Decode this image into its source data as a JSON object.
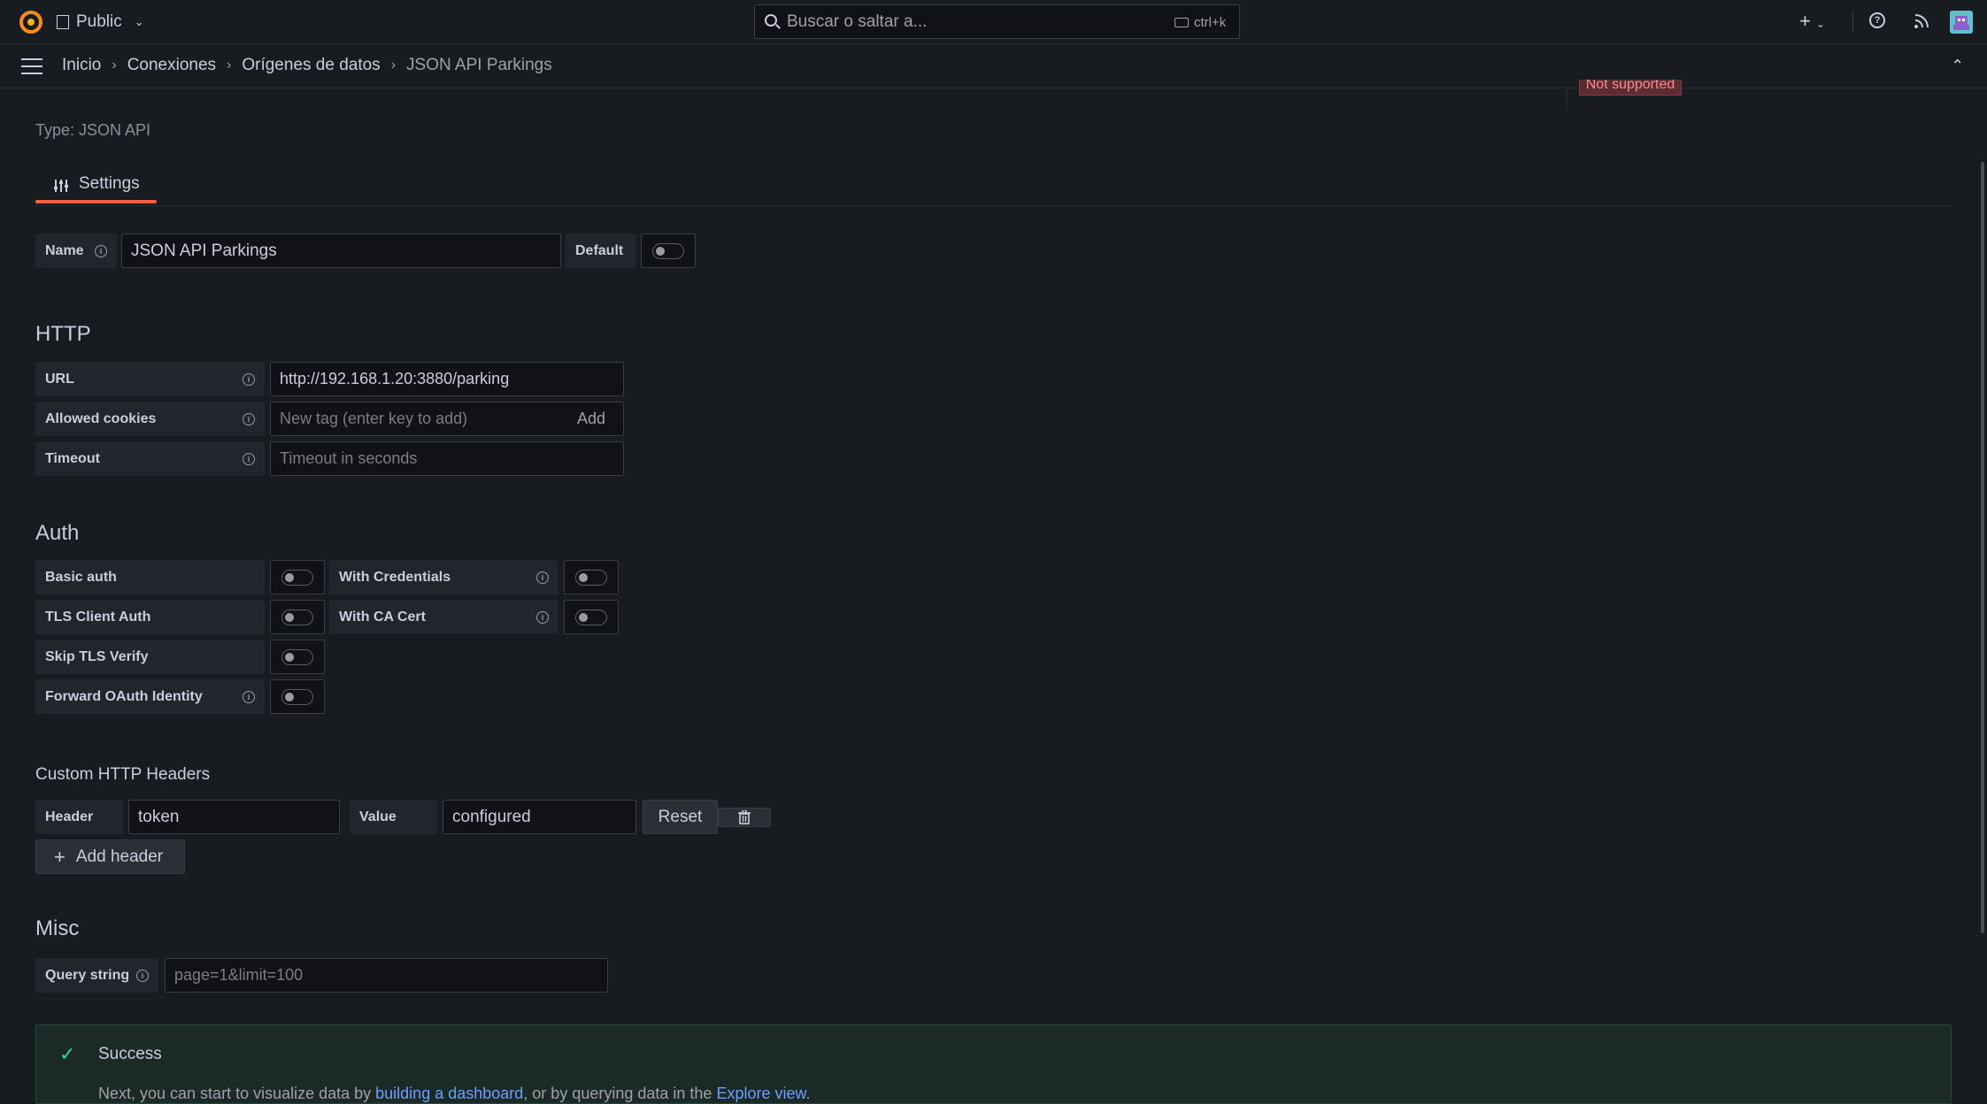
{
  "topbar": {
    "org_label": "Public",
    "search_placeholder": "Buscar o saltar a...",
    "search_shortcut": "ctrl+k"
  },
  "breadcrumb": [
    "Inicio",
    "Conexiones",
    "Orígenes de datos",
    "JSON API Parkings"
  ],
  "partial_badge": "Not supported",
  "type_text": "Type: JSON API",
  "tab": {
    "label": "Settings"
  },
  "name_row": {
    "label": "Name",
    "value": "JSON API Parkings",
    "default_label": "Default"
  },
  "http": {
    "title": "HTTP",
    "url_label": "URL",
    "url_value": "http://192.168.1.20:3880/parking",
    "cookies_label": "Allowed cookies",
    "cookies_placeholder": "New tag (enter key to add)",
    "cookies_add": "Add",
    "timeout_label": "Timeout",
    "timeout_placeholder": "Timeout in seconds"
  },
  "auth": {
    "title": "Auth",
    "basic_auth": "Basic auth",
    "with_credentials": "With Credentials",
    "tls_client_auth": "TLS Client Auth",
    "with_ca_cert": "With CA Cert",
    "skip_tls_verify": "Skip TLS Verify",
    "forward_oauth": "Forward OAuth Identity"
  },
  "headers": {
    "title": "Custom HTTP Headers",
    "header_label": "Header",
    "header_value": "token",
    "value_label": "Value",
    "value_value": "configured",
    "reset": "Reset",
    "add_header": "Add header"
  },
  "misc": {
    "title": "Misc",
    "query_label": "Query string",
    "query_placeholder": "page=1&limit=100"
  },
  "alert": {
    "title": "Success",
    "text_1": "Next, you can start to visualize data by ",
    "link_1": "building a dashboard",
    "text_2": ", or by querying data in the ",
    "link_2": "Explore view",
    "text_3": "."
  },
  "colors": {
    "accent": "#f55f3e",
    "success": "#1a7f4b",
    "link": "#6e9fff",
    "danger_badge": "#5a2c33"
  }
}
